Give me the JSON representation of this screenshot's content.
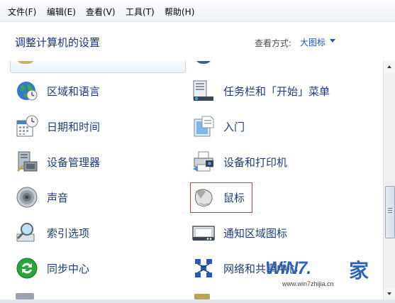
{
  "menubar": {
    "items": [
      "文件(F)",
      "编辑(E)",
      "查看(V)",
      "工具(T)",
      "帮助(H)"
    ]
  },
  "header": {
    "title": "调整计算机的设置",
    "view_label": "查看方式:",
    "view_value": "大图标"
  },
  "items": [
    {
      "label": "区域和语言",
      "icon": "globe-clock-icon"
    },
    {
      "label": "任务栏和「开始」菜单",
      "icon": "taskbar-icon"
    },
    {
      "label": "日期和时间",
      "icon": "calendar-clock-icon"
    },
    {
      "label": "入门",
      "icon": "getting-started-icon"
    },
    {
      "label": "设备管理器",
      "icon": "device-manager-icon"
    },
    {
      "label": "设备和打印机",
      "icon": "printer-camera-icon"
    },
    {
      "label": "声音",
      "icon": "speaker-icon"
    },
    {
      "label": "鼠标",
      "icon": "mouse-icon"
    },
    {
      "label": "索引选项",
      "icon": "magnifier-icon"
    },
    {
      "label": "通知区域图标",
      "icon": "notification-area-icon"
    },
    {
      "label": "同步中心",
      "icon": "sync-center-icon"
    },
    {
      "label": "网络和共享中心",
      "icon": "network-icon"
    }
  ],
  "watermark": {
    "brand": "WiN7.",
    "brand_suffix": "家",
    "url": "www.win7zhijia.cn"
  },
  "colors": {
    "link": "#1e3d7a",
    "title": "#1e3287",
    "accent": "#1e50c8",
    "highlight_border": "#d23c3c"
  }
}
